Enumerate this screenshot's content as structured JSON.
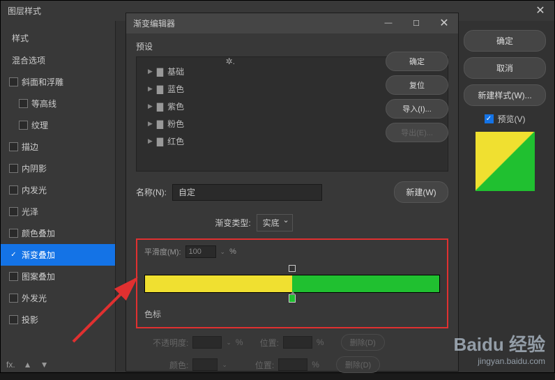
{
  "layer_style": {
    "title": "图层样式",
    "styles_header": "样式",
    "blend_options": "混合选项",
    "effects": [
      {
        "label": "斜面和浮雕",
        "checked": false
      },
      {
        "label": "等高线",
        "checked": false,
        "indent": true,
        "nocheck": false
      },
      {
        "label": "纹理",
        "checked": false,
        "indent": true,
        "nocheck": false
      },
      {
        "label": "描边",
        "checked": false
      },
      {
        "label": "内阴影",
        "checked": false
      },
      {
        "label": "内发光",
        "checked": false
      },
      {
        "label": "光泽",
        "checked": false
      },
      {
        "label": "颜色叠加",
        "checked": false
      },
      {
        "label": "渐变叠加",
        "checked": true,
        "selected": true
      },
      {
        "label": "图案叠加",
        "checked": false
      },
      {
        "label": "外发光",
        "checked": false
      },
      {
        "label": "投影",
        "checked": false
      }
    ],
    "footer": {
      "fx": "fx.",
      "up": "▲",
      "down": "▼"
    }
  },
  "right": {
    "ok": "确定",
    "cancel": "取消",
    "new_style": "新建样式(W)...",
    "preview": "预览(V)"
  },
  "gradient_editor": {
    "title": "渐变编辑器",
    "presets_label": "预设",
    "folders": [
      "基础",
      "蓝色",
      "紫色",
      "粉色",
      "红色"
    ],
    "buttons": {
      "ok": "确定",
      "reset": "复位",
      "import": "导入(I)...",
      "export": "导出(E)..."
    },
    "name_label": "名称(N):",
    "name_value": "自定",
    "new_btn": "新建(W)",
    "type_label": "渐变类型:",
    "type_value": "实底",
    "smoothness_label": "平滑度(M):",
    "smoothness_value": "100",
    "smoothness_unit": "%",
    "stops_label": "色标",
    "opacity_label": "不透明度:",
    "position_label": "位置:",
    "color_label": "颜色:",
    "percent": "%",
    "delete": "删除(D)"
  },
  "watermark": {
    "logo": "Baidu 经验",
    "url": "jingyan.baidu.com"
  },
  "chart_data": {
    "type": "bar",
    "note": "gradient stops",
    "stops": [
      {
        "position": 0,
        "color": "#f0e030"
      },
      {
        "position": 50,
        "color": "#f0e030"
      },
      {
        "position": 50,
        "color": "#20c030"
      },
      {
        "position": 100,
        "color": "#20c030"
      }
    ]
  }
}
